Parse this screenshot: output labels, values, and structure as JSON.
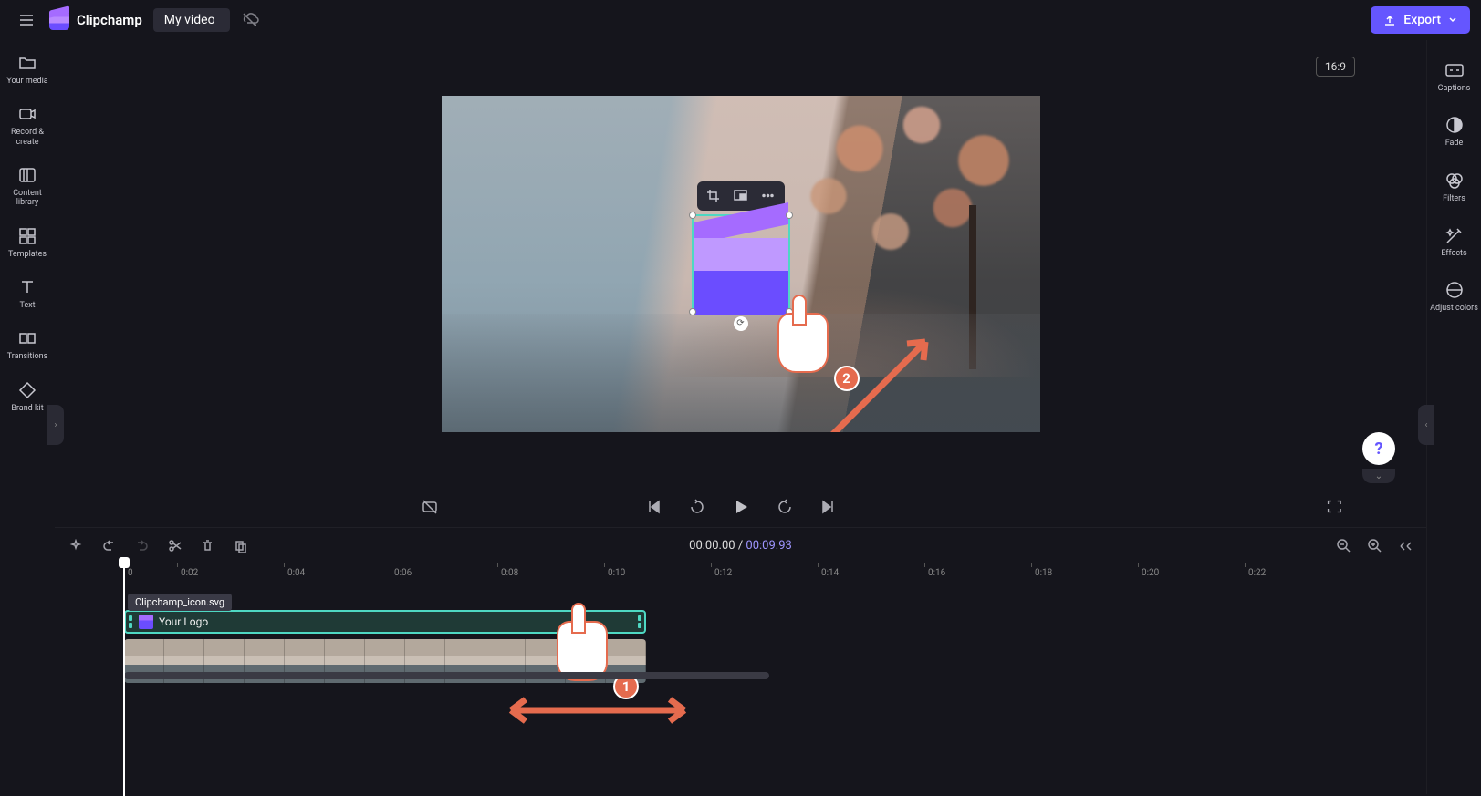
{
  "header": {
    "app_name": "Clipchamp",
    "project_title": "My video",
    "export_label": "Export"
  },
  "left_sidebar": {
    "items": [
      {
        "label": "Your media"
      },
      {
        "label": "Record & create"
      },
      {
        "label": "Content library"
      },
      {
        "label": "Templates"
      },
      {
        "label": "Text"
      },
      {
        "label": "Transitions"
      },
      {
        "label": "Brand kit"
      }
    ]
  },
  "right_sidebar": {
    "items": [
      {
        "label": "Captions"
      },
      {
        "label": "Fade"
      },
      {
        "label": "Filters"
      },
      {
        "label": "Effects"
      },
      {
        "label": "Adjust colors"
      }
    ]
  },
  "canvas": {
    "aspect_ratio": "16:9",
    "annotations": {
      "badge1": "1",
      "badge2": "2"
    }
  },
  "playback": {
    "current_time": "00:00.00",
    "separator": "/",
    "duration": "00:09.93"
  },
  "ruler": {
    "ticks": [
      "0",
      "0:02",
      "0:04",
      "0:06",
      "0:08",
      "0:10",
      "0:12",
      "0:14",
      "0:16",
      "0:18",
      "0:20",
      "0:22"
    ]
  },
  "timeline": {
    "tooltip": "Clipchamp_icon.svg",
    "logo_clip_label": "Your Logo"
  },
  "help": {
    "label": "?"
  }
}
